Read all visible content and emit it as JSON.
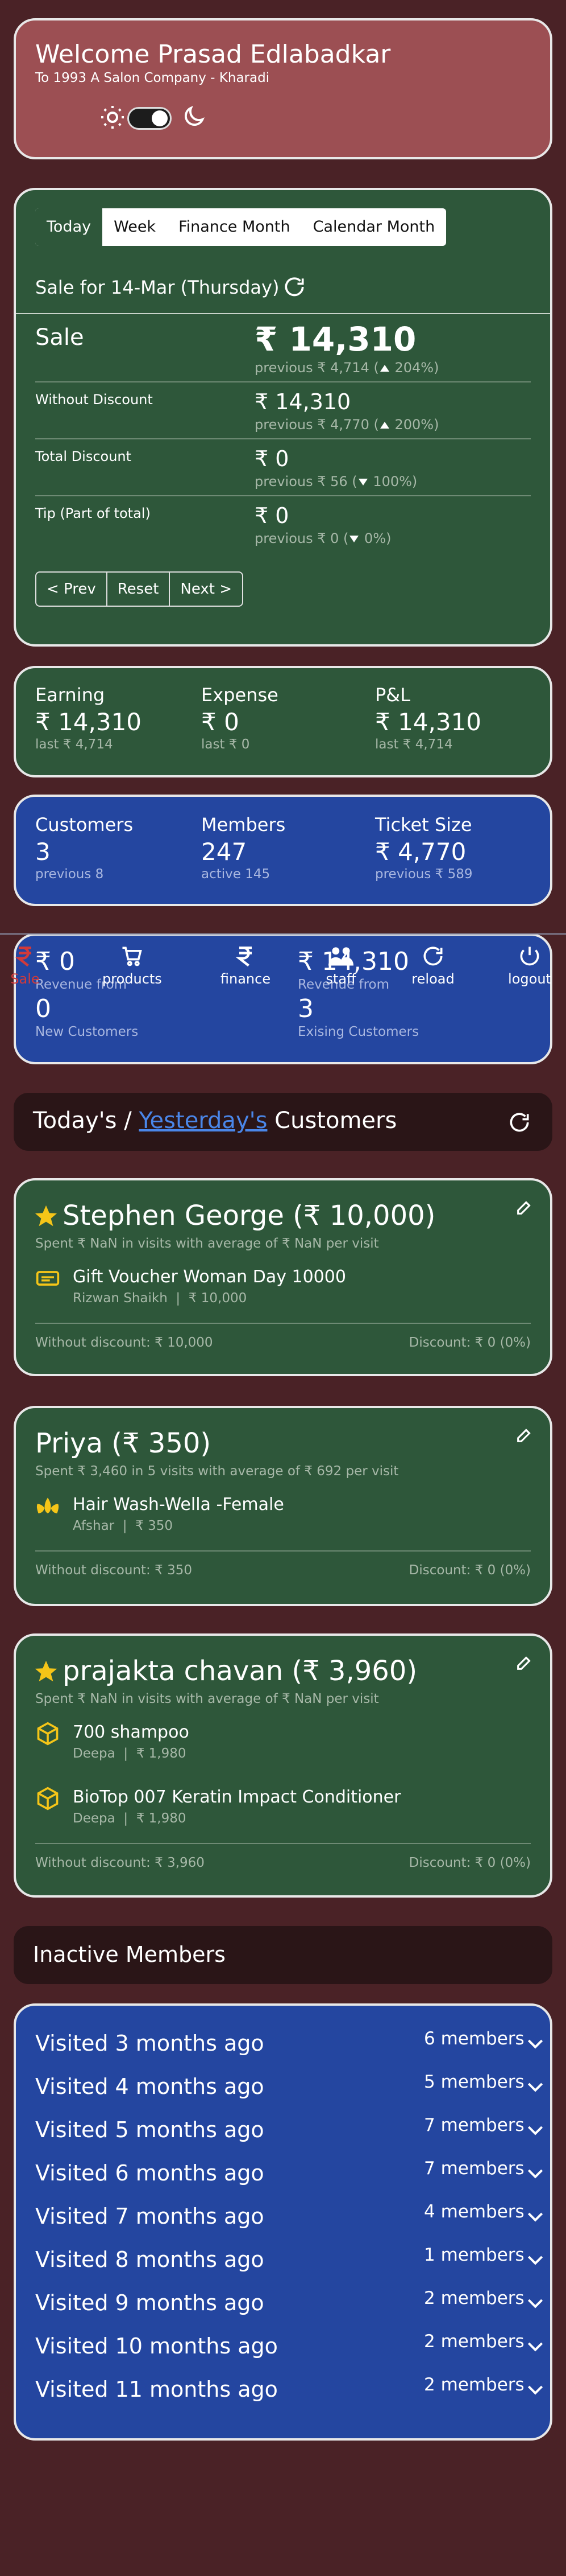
{
  "header": {
    "title": "Welcome Prasad Edlabadkar",
    "subtitle": "To 1993 A Salon Company - Kharadi"
  },
  "sale_card": {
    "tabs": [
      "Today",
      "Week",
      "Finance Month",
      "Calendar Month"
    ],
    "active_tab": "Today",
    "date_label": "Sale for 14-Mar (Thursday)",
    "rows": [
      {
        "label": "Sale",
        "value": "₹ 14,310",
        "previous": "previous ₹ 4,714 (",
        "change": "204%)",
        "direction": "up"
      },
      {
        "label": "Without Discount",
        "value": "₹ 14,310",
        "previous": "previous ₹ 4,770 (",
        "change": "200%)",
        "direction": "up"
      },
      {
        "label": "Total Discount",
        "value": "₹ 0",
        "previous": "previous ₹ 56 (",
        "change": "100%)",
        "direction": "down"
      },
      {
        "label": "Tip (Part of total)",
        "value": "₹ 0",
        "previous": "previous ₹ 0 (",
        "change": "0%)",
        "direction": "down"
      }
    ],
    "buttons": [
      "< Prev",
      "Reset",
      "Next >"
    ]
  },
  "earnings": [
    {
      "label": "Earning",
      "value": "₹ 14,310",
      "sub": "last ₹ 4,714"
    },
    {
      "label": "Expense",
      "value": "₹ 0",
      "sub": "last ₹ 0"
    },
    {
      "label": "P&L",
      "value": "₹ 14,310",
      "sub": "last ₹ 4,714"
    }
  ],
  "customers": [
    {
      "label": "Customers",
      "value": "3",
      "sub": "previous 8"
    },
    {
      "label": "Members",
      "value": "247",
      "sub": "active 145"
    },
    {
      "label": "Ticket Size",
      "value": "₹ 4,770",
      "sub": "previous ₹ 589"
    }
  ],
  "new_customers": {
    "revenue_left": "₹ 0",
    "revenue_left_sub": "Revenue from",
    "count_left": "0",
    "count_left_label": "New Customers",
    "revenue_right": "₹ 14,310",
    "revenue_right_sub": "Revenue from",
    "count_right": "3",
    "count_right_label": "Exising Customers"
  },
  "bottom_nav": {
    "items": [
      "Sale",
      "products",
      "finance",
      "staff",
      "reload",
      "logout"
    ]
  },
  "today_header": {
    "prefix": "Today's / ",
    "link": "Yesterday's",
    "suffix": " Customers"
  },
  "customer_cards": [
    {
      "name": "Stephen George (₹ 10,000)",
      "starred": true,
      "spent": "Spent ₹ NaN in visits with average of ₹ NaN per visit",
      "items": [
        {
          "icon": "voucher-icon",
          "name": "Gift Voucher Woman Day 10000",
          "staff": "Rizwan Shaikh",
          "price": "₹ 10,000"
        }
      ],
      "without_discount": "Without discount: ₹ 10,000",
      "discount": "Discount: ₹ 0 (0%)"
    },
    {
      "name": "Priya (₹ 350)",
      "starred": false,
      "spent": "Spent ₹ 3,460 in 5 visits with average of ₹ 692 per visit",
      "items": [
        {
          "icon": "lotus-icon",
          "name": "Hair Wash-Wella -Female",
          "staff": "Afshar",
          "price": "₹ 350"
        }
      ],
      "without_discount": "Without discount: ₹ 350",
      "discount": "Discount: ₹ 0 (0%)"
    },
    {
      "name": "prajakta chavan (₹ 3,960)",
      "starred": true,
      "spent": "Spent ₹ NaN in visits with average of ₹ NaN per visit",
      "items": [
        {
          "icon": "box-icon",
          "name": "700 shampoo",
          "staff": "Deepa",
          "price": "₹ 1,980"
        },
        {
          "icon": "box-icon",
          "name": "BioTop 007 Keratin Impact Conditioner",
          "staff": "Deepa",
          "price": "₹ 1,980"
        }
      ],
      "without_discount": "Without discount: ₹ 3,960",
      "discount": "Discount: ₹ 0 (0%)"
    }
  ],
  "inactive": {
    "title": "Inactive Members",
    "rows": [
      {
        "label": "Visited 3 months ago",
        "members": "6 members"
      },
      {
        "label": "Visited 4 months ago",
        "members": "5 members"
      },
      {
        "label": "Visited 5 months ago",
        "members": "7 members"
      },
      {
        "label": "Visited 6 months ago",
        "members": "7 members"
      },
      {
        "label": "Visited 7 months ago",
        "members": "4 members"
      },
      {
        "label": "Visited 8 months ago",
        "members": "1 members"
      },
      {
        "label": "Visited 9 months ago",
        "members": "2 members"
      },
      {
        "label": "Visited 10 months ago",
        "members": "2 members"
      },
      {
        "label": "Visited 11 months ago",
        "members": "2 members"
      }
    ]
  },
  "colors": {
    "background": "#4a2226",
    "header": "#9c4f53",
    "green_card": "#2e573a",
    "blue_card": "#2446a0",
    "star": "#f5c518",
    "link": "#4a86e8"
  }
}
